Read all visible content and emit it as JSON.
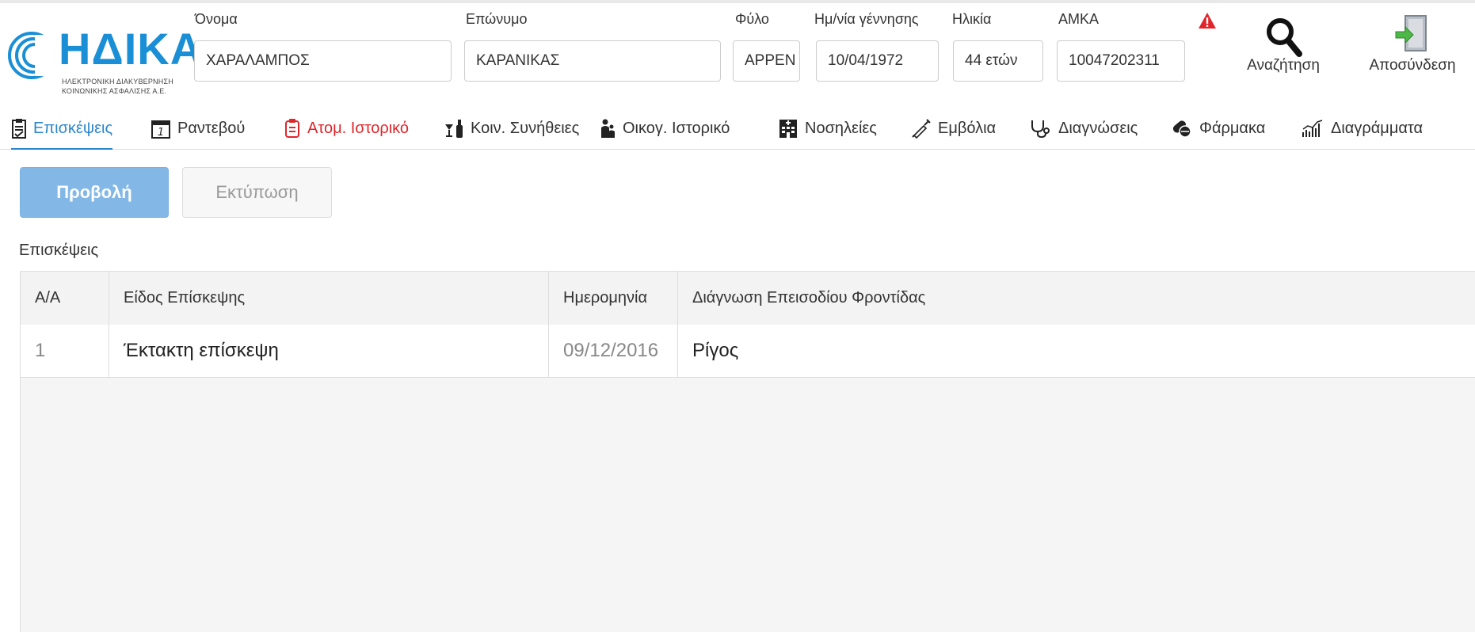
{
  "logo": {
    "name": "ΗΔΙΚΑ",
    "subtitle_line1": "ΗΛΕΚΤΡΟΝΙΚΗ ΔΙΑΚΥΒΕΡΝΗΣΗ",
    "subtitle_line2": "ΚΟΙΝΩΝΙΚΗΣ ΑΣΦΑΛΙΣΗΣ Α.Ε.",
    "color": "#1a8fd6"
  },
  "patient": {
    "first_name_label": "Όνομα",
    "first_name": "ΧΑΡΑΛΑΜΠΟΣ",
    "last_name_label": "Επώνυμο",
    "last_name": "ΚΑΡΑΝΙΚΑΣ",
    "gender_label": "Φύλο",
    "gender": "ΑΡΡΕΝ",
    "birthdate_label": "Ημ/νία γέννησης",
    "birthdate": "10/04/1972",
    "age_label": "Ηλικία",
    "age": "44 ετών",
    "amka_label": "ΑΜΚΑ",
    "amka": "10047202311"
  },
  "header_actions": {
    "search_label": "Αναζήτηση",
    "logout_label": "Αποσύνδεση",
    "alert_icon": "warning-icon",
    "alert_color": "#e0262b"
  },
  "tabs": [
    {
      "label": "Επισκέψεις",
      "icon": "clipboard-icon",
      "state": "active"
    },
    {
      "label": "Ραντεβού",
      "icon": "calendar-icon"
    },
    {
      "label": "Ατομ. Ιστορικό",
      "icon": "history-icon",
      "state": "alert"
    },
    {
      "label": "Κοιν. Συνήθειες",
      "icon": "habits-icon"
    },
    {
      "label": "Οικογ. Ιστορικό",
      "icon": "family-icon"
    },
    {
      "label": "Νοσηλείες",
      "icon": "hospital-icon"
    },
    {
      "label": "Εμβόλια",
      "icon": "syringe-icon"
    },
    {
      "label": "Διαγνώσεις",
      "icon": "stethoscope-icon"
    },
    {
      "label": "Φάρμακα",
      "icon": "pills-icon"
    },
    {
      "label": "Διαγράμματα",
      "icon": "chart-icon"
    }
  ],
  "actions": {
    "view_label": "Προβολή",
    "print_label": "Εκτύπωση"
  },
  "section_title": "Επισκέψεις",
  "table": {
    "columns": [
      "Α/Α",
      "Είδος Επίσκεψης",
      "Ημερομηνία",
      "Διάγνωση Επεισοδίου Φροντίδας"
    ],
    "rows": [
      [
        "1",
        "Έκτακτη επίσκεψη",
        "09/12/2016",
        "Ρίγος"
      ]
    ]
  },
  "colors": {
    "accent": "#2a86cc",
    "alert": "#e0262b",
    "primary_button": "#83b8e6"
  }
}
